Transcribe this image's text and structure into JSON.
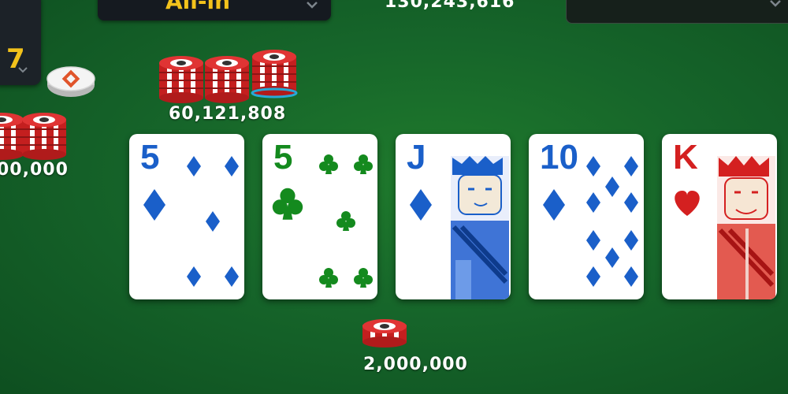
{
  "top_left_seat": {
    "number": "7",
    "icon": "chevron-down-icon"
  },
  "action_select": {
    "label": "All-in",
    "icon": "chevron-down-icon"
  },
  "pot_total": "130,243,616",
  "right_select": {
    "icon": "chevron-down-icon"
  },
  "dealer_button": {
    "icon": "dealer-button-icon"
  },
  "bets": {
    "center_top": "60,121,808",
    "left": "00,000",
    "bottom": "2,000,000"
  },
  "board": [
    {
      "rank": "5",
      "suit": "diamonds",
      "color": "#1a5fc9"
    },
    {
      "rank": "5",
      "suit": "clubs",
      "color": "#148a1e"
    },
    {
      "rank": "J",
      "suit": "diamonds",
      "color": "#1a5fc9"
    },
    {
      "rank": "10",
      "suit": "diamonds",
      "color": "#1a5fc9"
    },
    {
      "rank": "K",
      "suit": "hearts",
      "color": "#d42020"
    }
  ],
  "colors": {
    "felt": "#16652a",
    "accent_gold": "#f2c21b",
    "chip_red": "#d32a2a"
  }
}
